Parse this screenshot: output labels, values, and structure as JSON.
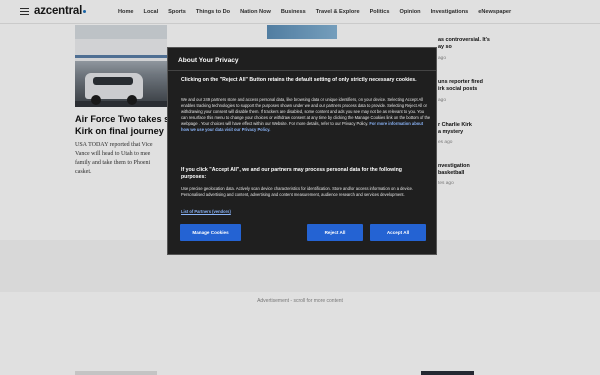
{
  "header": {
    "logo": "azcentral",
    "nav": [
      "Home",
      "Local",
      "Sports",
      "Things to Do",
      "Nation Now",
      "Business",
      "Travel & Explore",
      "Politics",
      "Opinion",
      "Investigations",
      "eNewspaper"
    ]
  },
  "article": {
    "headline_lines": [
      "Air Force Two takes s",
      "Kirk on final journey h"
    ],
    "summary_lines": [
      "USA TODAY reported that Vice",
      "Vance will head to Utah to mee",
      "family and take them to Phoeni",
      "casket."
    ]
  },
  "right_rail": [
    {
      "text_lines": [
        "as controversial. It's",
        "ay so"
      ],
      "time": ""
    },
    {
      "text_lines": [
        ""
      ],
      "time": "ago"
    },
    {
      "text_lines": [
        "uns reporter fired",
        "irk social posts"
      ],
      "time": "ago"
    },
    {
      "text_lines": [
        "r Charlie Kirk",
        "a mystery"
      ],
      "time": "es ago"
    },
    {
      "text_lines": [
        "nvestigation",
        "basketball"
      ],
      "time": "tes ago"
    }
  ],
  "ad_text": "Advertisement - scroll for more content",
  "privacy_modal": {
    "title": "About Your Privacy",
    "heading1": "Clicking on the \"Reject All\" Button retains the default setting of only strictly necessary cookies.",
    "body1": "We and our 249 partners store and access personal data, like browsing data or unique identifiers, on your device. Selecting Accept All enables tracking technologies to support the purposes shown under we and our partners process data to provide. Selecting Reject All or withdrawing your consent will disable them. If trackers are disabled, some content and ads you see may not be as relevant to you. You can resurface this menu to change your choices or withdraw consent at any time by clicking the Manage Cookies link on the bottom of the webpage . Your choices will have effect within our Website. For more details, refer to our Privacy Policy.",
    "body1_link": "For more information about how we use your data visit our Privacy Policy.",
    "heading2": "If you click \"Accept All\", we and our partners may process personal data for the following purposes:",
    "body2": "Use precise geolocation data. Actively scan device characteristics for identification. Store and/or access information on a device. Personalised advertising and content, advertising and content measurement, audience research and services development.",
    "partners_link": "List of Partners (vendors)",
    "manage_label": "Manage Cookies",
    "reject_label": "Reject All",
    "accept_label": "Accept All"
  },
  "colors": {
    "accent": "#2463d3",
    "modal_bg": "#1f1f1f",
    "link": "#8ab4f8"
  }
}
